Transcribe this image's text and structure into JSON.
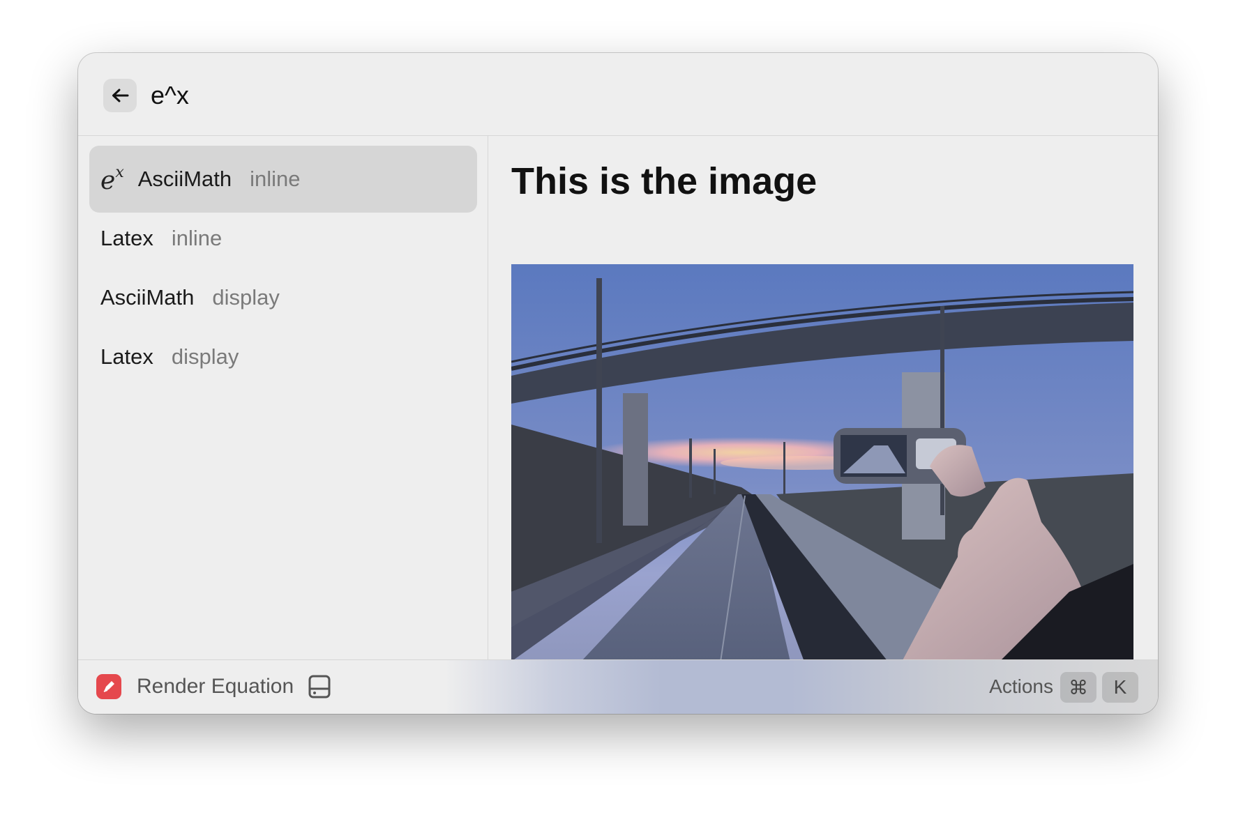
{
  "search": {
    "query": "e^x"
  },
  "results": [
    {
      "title": "AsciiMath",
      "subtitle": "inline",
      "selected": true,
      "formula_base": "e",
      "formula_exp": "x"
    },
    {
      "title": "Latex",
      "subtitle": "inline",
      "selected": false
    },
    {
      "title": "AsciiMath",
      "subtitle": "display",
      "selected": false
    },
    {
      "title": "Latex",
      "subtitle": "display",
      "selected": false
    }
  ],
  "detail": {
    "title": "This is the image",
    "image": "photo-hand-holding-phone-under-bridge"
  },
  "footer": {
    "extension_name": "Render Equation",
    "actions_label": "Actions",
    "shortcut_keys": [
      "⌘",
      "K"
    ]
  },
  "colors": {
    "window_bg": "#eeeeee",
    "selected_row": "#d6d6d6",
    "extension_icon": "#e5484d"
  }
}
